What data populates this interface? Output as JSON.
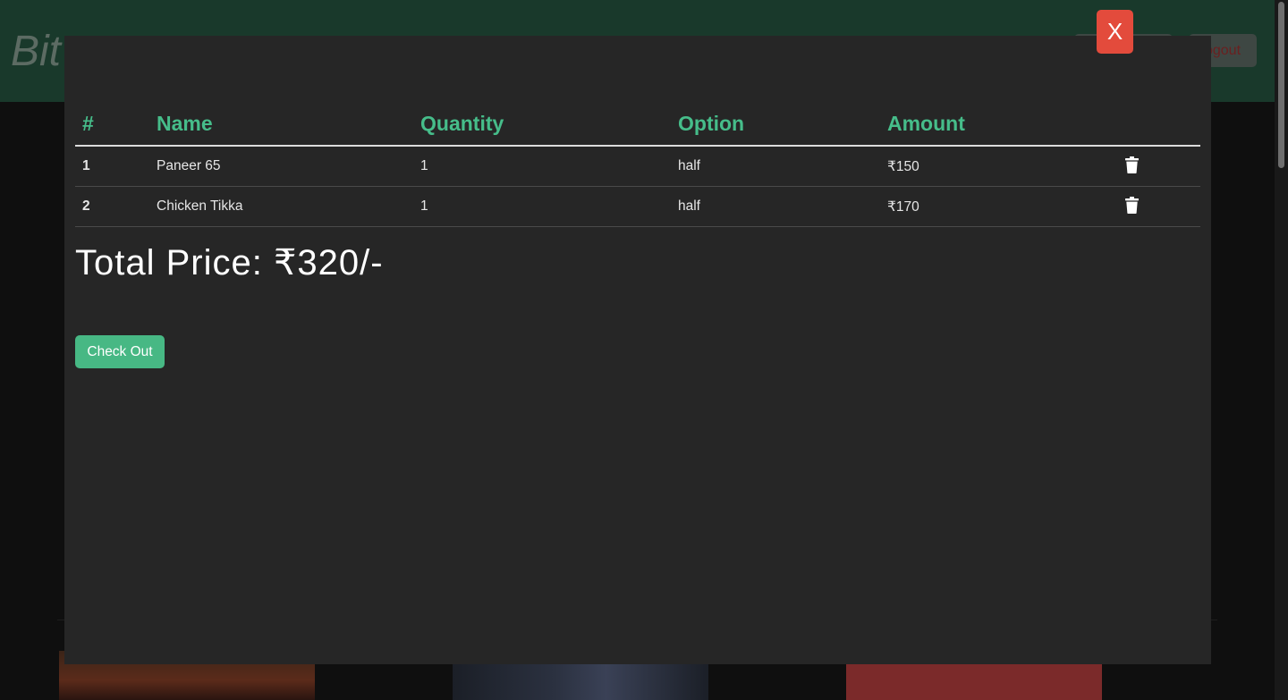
{
  "background": {
    "brand": "Bit",
    "nav": {
      "cart_label": "",
      "logout_label": "ogout"
    }
  },
  "modal": {
    "close_label": "X",
    "table": {
      "headers": [
        "#",
        "Name",
        "Quantity",
        "Option",
        "Amount"
      ],
      "rows": [
        {
          "index": "1",
          "name": "Paneer 65",
          "quantity": "1",
          "option": "half",
          "amount": "₹150"
        },
        {
          "index": "2",
          "name": "Chicken Tikka",
          "quantity": "1",
          "option": "half",
          "amount": "₹170"
        }
      ]
    },
    "total_text": "Total Price: ₹320/-",
    "checkout_label": "Check Out"
  },
  "colors": {
    "accent": "#46bd8a",
    "danger": "#e34b3c",
    "modal_bg": "#262626",
    "navbar_bg": "#19392b"
  }
}
